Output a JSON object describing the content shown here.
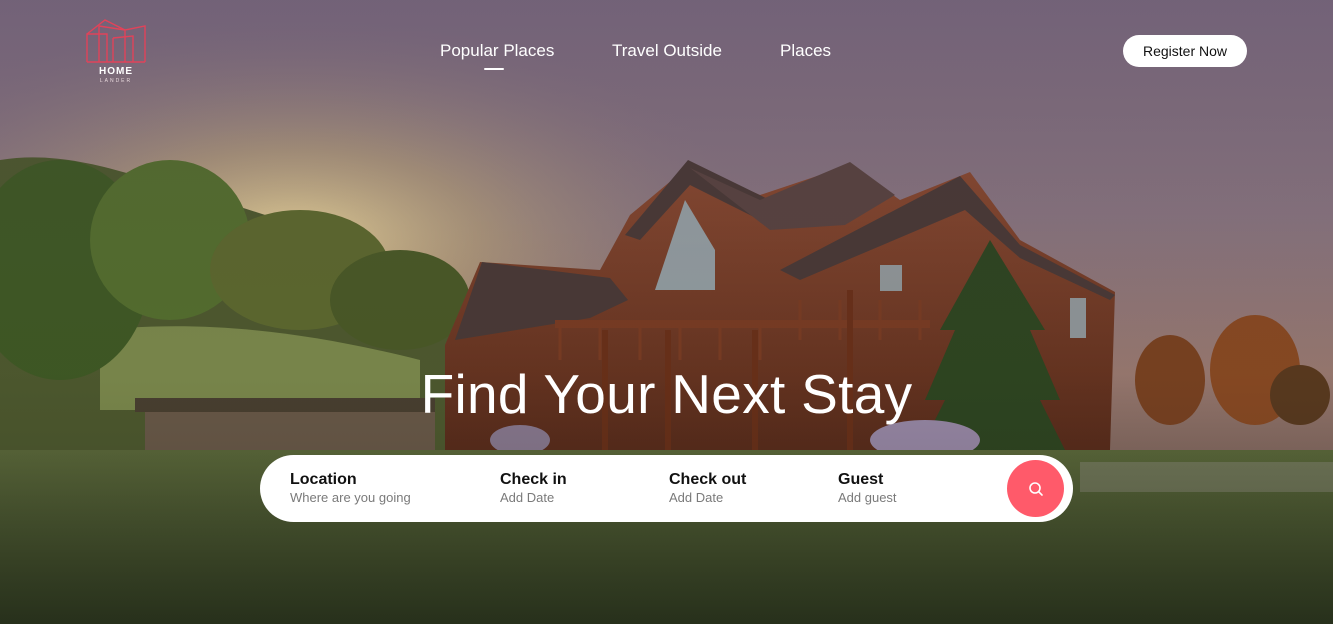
{
  "brand": {
    "name": "HOME",
    "tagline": "LANDER",
    "accent": "#e0435a"
  },
  "nav": {
    "items": [
      {
        "label": "Popular Places",
        "active": true
      },
      {
        "label": "Travel Outside",
        "active": false
      },
      {
        "label": "Places",
        "active": false
      }
    ]
  },
  "header": {
    "register_label": "Register Now"
  },
  "hero": {
    "headline": "Find Your Next Stay"
  },
  "search": {
    "fields": [
      {
        "label": "Location",
        "hint": "Where are you going"
      },
      {
        "label": "Check in",
        "hint": "Add Date"
      },
      {
        "label": "Check out",
        "hint": "Add Date"
      },
      {
        "label": "Guest",
        "hint": "Add guest"
      }
    ],
    "button_icon": "search-icon",
    "button_color": "#ff5a6a"
  }
}
